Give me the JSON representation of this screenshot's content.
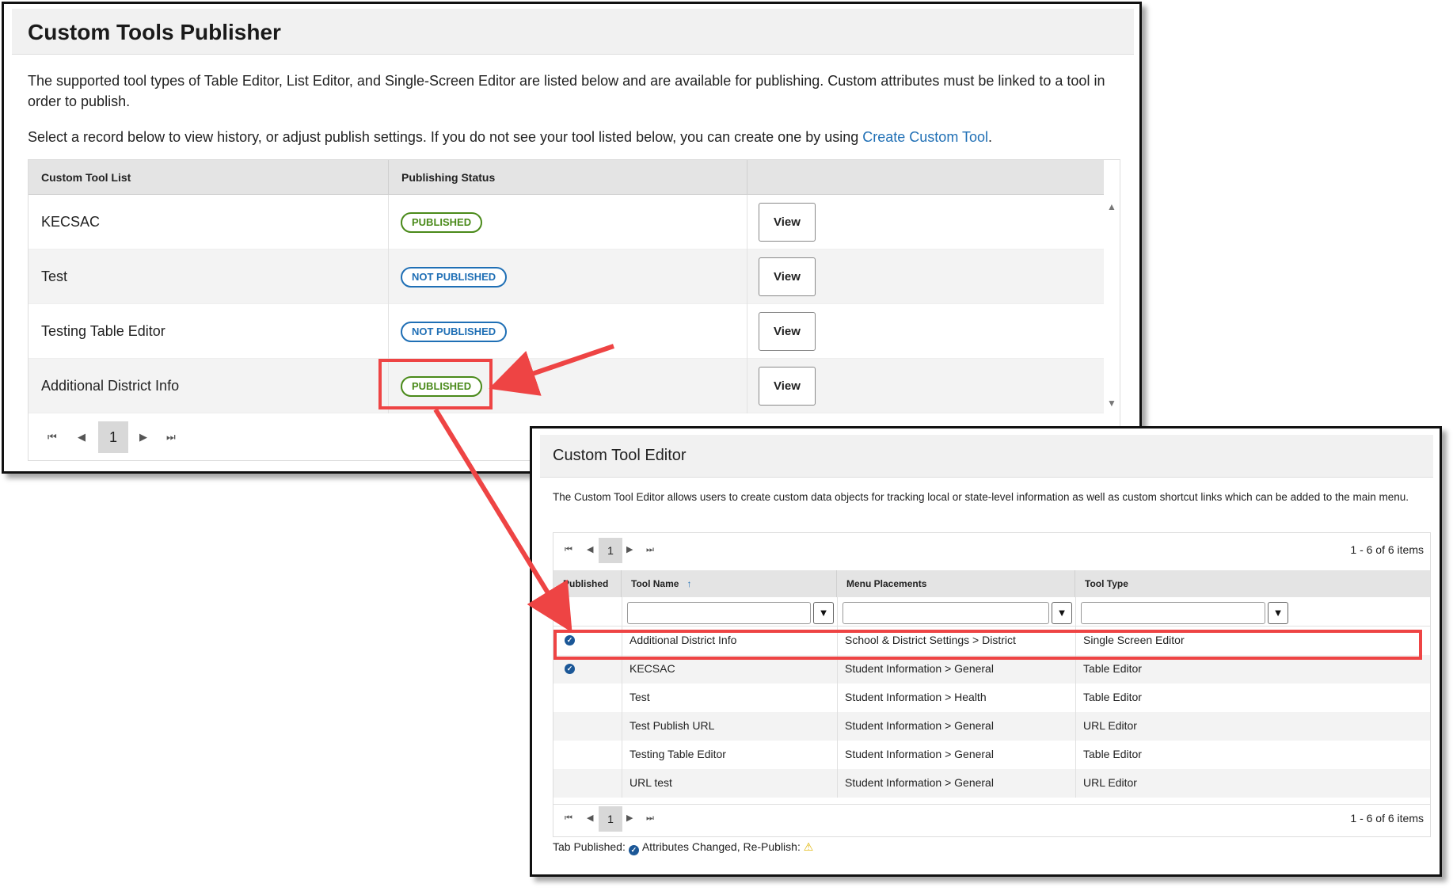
{
  "publisher": {
    "title": "Custom Tools Publisher",
    "description": "The supported tool types of Table Editor, List Editor, and Single-Screen Editor are listed below and are available for publishing. Custom attributes must be linked to a tool in order to publish.",
    "select_prefix": "Select a record below to view history, or adjust publish settings. If you do not see your tool listed below, you can create one by using ",
    "select_link": "Create Custom Tool",
    "select_suffix": ".",
    "columns": [
      "Custom Tool List",
      "Publishing Status",
      ""
    ],
    "rows": [
      {
        "name": "KECSAC",
        "status": "PUBLISHED",
        "action": "View"
      },
      {
        "name": "Test",
        "status": "NOT PUBLISHED",
        "action": "View"
      },
      {
        "name": "Testing Table Editor",
        "status": "NOT PUBLISHED",
        "action": "View"
      },
      {
        "name": "Additional District Info",
        "status": "PUBLISHED",
        "action": "View"
      }
    ],
    "page": "1"
  },
  "editor": {
    "title": "Custom Tool Editor",
    "description": "The Custom Tool Editor allows users to create custom data objects for tracking local or state-level information as well as custom shortcut links which can be added to the main menu.",
    "page": "1",
    "count": "1 - 6 of 6 items",
    "columns": [
      "Published",
      "Tool Name",
      "Menu Placements",
      "Tool Type"
    ],
    "rows": [
      {
        "published": true,
        "name": "Additional District Info",
        "menu": "School & District Settings > District",
        "type": "Single Screen Editor"
      },
      {
        "published": true,
        "name": "KECSAC",
        "menu": "Student Information > General",
        "type": "Table Editor"
      },
      {
        "published": false,
        "name": "Test",
        "menu": "Student Information > Health",
        "type": "Table Editor"
      },
      {
        "published": false,
        "name": "Test Publish URL",
        "menu": "Student Information > General",
        "type": "URL Editor"
      },
      {
        "published": false,
        "name": "Testing Table Editor",
        "menu": "Student Information > General",
        "type": "Table Editor"
      },
      {
        "published": false,
        "name": "URL test",
        "menu": "Student Information > General",
        "type": "URL Editor"
      }
    ],
    "legend_tab": "Tab Published:",
    "legend_changed": "Attributes Changed, Re-Publish:"
  },
  "colors": {
    "published_green": "#4a8a1a",
    "not_published_blue": "#1f6fb5",
    "annotation_red": "#ee4444",
    "check_blue": "#1b5797"
  }
}
